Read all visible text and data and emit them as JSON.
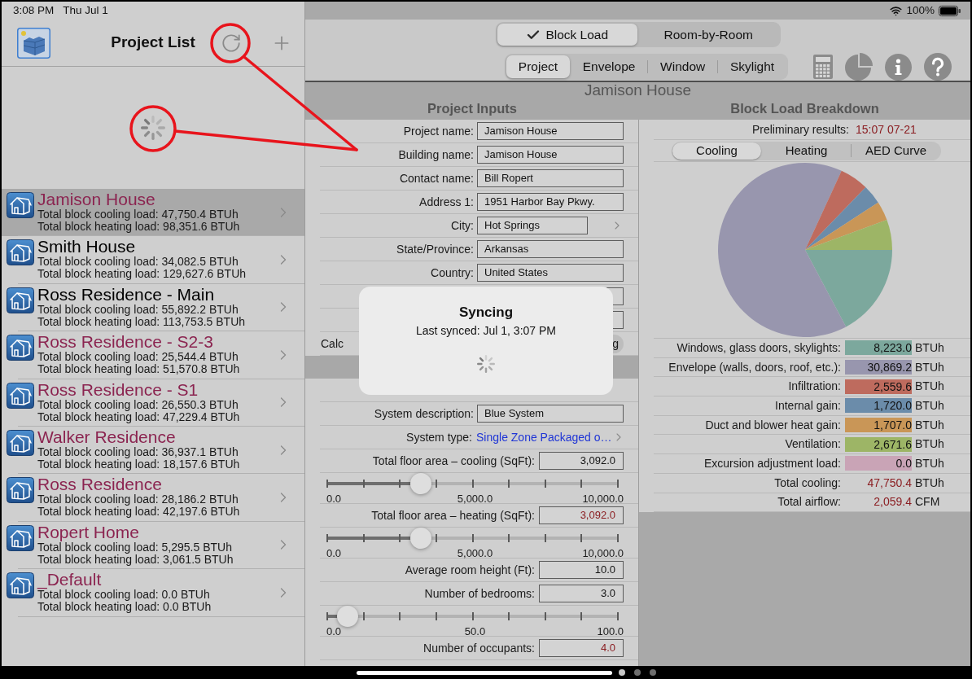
{
  "status_bar": {
    "time": "3:08 PM",
    "date": "Thu Jul 1",
    "battery": "100%"
  },
  "sidebar": {
    "title": "Project List",
    "syncing": true,
    "projects": [
      {
        "name": "Jamison House",
        "cooling": "Total block cooling load: 47,750.4 BTUh",
        "heating": "Total block heating load: 98,351.6 BTUh",
        "color": "#8b2450",
        "selected": true
      },
      {
        "name": "Smith House",
        "cooling": "Total block cooling load: 34,082.5 BTUh",
        "heating": "Total block heating load: 129,627.6 BTUh",
        "color": "#000000",
        "selected": false
      },
      {
        "name": "Ross Residence - Main",
        "cooling": "Total block cooling load: 55,892.2 BTUh",
        "heating": "Total block heating load: 113,753.5 BTUh",
        "color": "#000000",
        "selected": false
      },
      {
        "name": "Ross Residence - S2-3",
        "cooling": "Total block cooling load: 25,544.4 BTUh",
        "heating": "Total block heating load: 51,570.8 BTUh",
        "color": "#8b2450",
        "selected": false
      },
      {
        "name": "Ross Residence - S1",
        "cooling": "Total block cooling load: 26,550.3 BTUh",
        "heating": "Total block heating load: 47,229.4 BTUh",
        "color": "#8b2450",
        "selected": false
      },
      {
        "name": "Walker Residence",
        "cooling": "Total block cooling load: 36,937.1 BTUh",
        "heating": "Total block heating load: 18,157.6 BTUh",
        "color": "#8b2450",
        "selected": false
      },
      {
        "name": "Ross Residence",
        "cooling": "Total block cooling load: 28,186.2 BTUh",
        "heating": "Total block heating load: 42,197.6 BTUh",
        "color": "#8b2450",
        "selected": false
      },
      {
        "name": "Ropert Home",
        "cooling": "Total block cooling load: 5,295.5 BTUh",
        "heating": "Total block heating load: 3,061.5 BTUh",
        "color": "#8b2450",
        "selected": false
      },
      {
        "name": "_Default",
        "cooling": "Total block cooling load: 0.0 BTUh",
        "heating": "Total block heating load: 0.0 BTUh",
        "color": "#8b2450",
        "selected": false
      }
    ]
  },
  "mode_tabs": [
    {
      "label": "Block Load",
      "selected": true
    },
    {
      "label": "Room-by-Room",
      "selected": false
    }
  ],
  "section_tabs": [
    {
      "label": "Project",
      "selected": true
    },
    {
      "label": "Envelope",
      "selected": false
    },
    {
      "label": "Window",
      "selected": false
    },
    {
      "label": "Skylight",
      "selected": false
    }
  ],
  "project_title": "Jamison House",
  "inputs": {
    "title": "Project Inputs",
    "rows": [
      {
        "kind": "text",
        "label": "Project name:",
        "value": "Jamison House"
      },
      {
        "kind": "text",
        "label": "Building name:",
        "value": "Jamison House"
      },
      {
        "kind": "text",
        "label": "Contact name:",
        "value": "Bill Ropert"
      },
      {
        "kind": "text",
        "label": "Address 1:",
        "value": "1951 Harbor Bay Pkwy."
      },
      {
        "kind": "picker",
        "label": "City:",
        "value": "Hot Springs"
      },
      {
        "kind": "text",
        "label": "State/Province:",
        "value": "Arkansas"
      },
      {
        "kind": "text",
        "label": "Country:",
        "value": "United States"
      },
      {
        "kind": "text"
      },
      {
        "kind": "text"
      },
      {
        "kind": "choice",
        "label": "Calc",
        "option": "g"
      },
      {
        "kind": "header"
      },
      {
        "kind": "blank"
      },
      {
        "kind": "text",
        "label": "System description:",
        "value": "Blue System"
      },
      {
        "kind": "link",
        "label": "System type:",
        "value": "Single Zone Packaged o…"
      },
      {
        "kind": "number",
        "label": "Total floor area – cooling (SqFt):",
        "value": "3,092.0",
        "highlighted": false
      },
      {
        "kind": "slider",
        "level": 0.31,
        "min": "0.0",
        "mid": "5,000.0",
        "max": "10,000.0"
      },
      {
        "kind": "number",
        "label": "Total floor area – heating (SqFt):",
        "value": "3,092.0",
        "highlighted": true
      },
      {
        "kind": "slider",
        "level": 0.31,
        "min": "0.0",
        "mid": "5,000.0",
        "max": "10,000.0"
      },
      {
        "kind": "number",
        "label": "Average room height (Ft):",
        "value": "10.0",
        "highlighted": false
      },
      {
        "kind": "number",
        "label": "Number of bedrooms:",
        "value": "3.0",
        "highlighted": false
      },
      {
        "kind": "slider",
        "level": 0.04,
        "min": "0.0",
        "mid": "50.0",
        "max": "100.0"
      },
      {
        "kind": "number",
        "label": "Number of occupants:",
        "value": "4.0",
        "highlighted": true
      }
    ]
  },
  "breakdown": {
    "title": "Block Load Breakdown",
    "status_label": "Preliminary results:",
    "status_value": "15:07 07-21",
    "tabs": [
      {
        "label": "Cooling",
        "selected": true
      },
      {
        "label": "Heating",
        "selected": false
      },
      {
        "label": "AED Curve",
        "selected": false
      }
    ],
    "chart_data": {
      "type": "pie",
      "values": [
        17.22,
        64.65,
        5.36,
        3.6,
        3.57,
        5.6
      ]
    },
    "rows": [
      {
        "kind": "component",
        "label": "Windows, glass doors, skylights:",
        "value": "8,223.0",
        "unit": "BTUh",
        "color": "#7ca89d"
      },
      {
        "kind": "component",
        "label": "Envelope (walls, doors, roof, etc.):",
        "value": "30,869.2",
        "unit": "BTUh",
        "color": "#9896ae"
      },
      {
        "kind": "component",
        "label": "Infiltration:",
        "value": "2,559.6",
        "unit": "BTUh",
        "color": "#be6b5e"
      },
      {
        "kind": "component",
        "label": "Internal gain:",
        "value": "1,720.0",
        "unit": "BTUh",
        "color": "#6b8caa"
      },
      {
        "kind": "component",
        "label": "Duct and blower heat gain:",
        "value": "1,707.0",
        "unit": "BTUh",
        "color": "#c99657"
      },
      {
        "kind": "component",
        "label": "Ventilation:",
        "value": "2,671.6",
        "unit": "BTUh",
        "color": "#9db566"
      },
      {
        "kind": "component",
        "label": "Excursion adjustment load:",
        "value": "0.0",
        "unit": "BTUh",
        "color": "#c9a4b6"
      },
      {
        "kind": "total",
        "label": "Total cooling:",
        "value": "47,750.4",
        "unit": "BTUh"
      },
      {
        "kind": "total",
        "label": "Total airflow:",
        "value": "2,059.4",
        "unit": "CFM"
      }
    ]
  },
  "sync_dialog": {
    "title": "Syncing",
    "message": "Last synced: Jul 1, 3:07 PM"
  }
}
